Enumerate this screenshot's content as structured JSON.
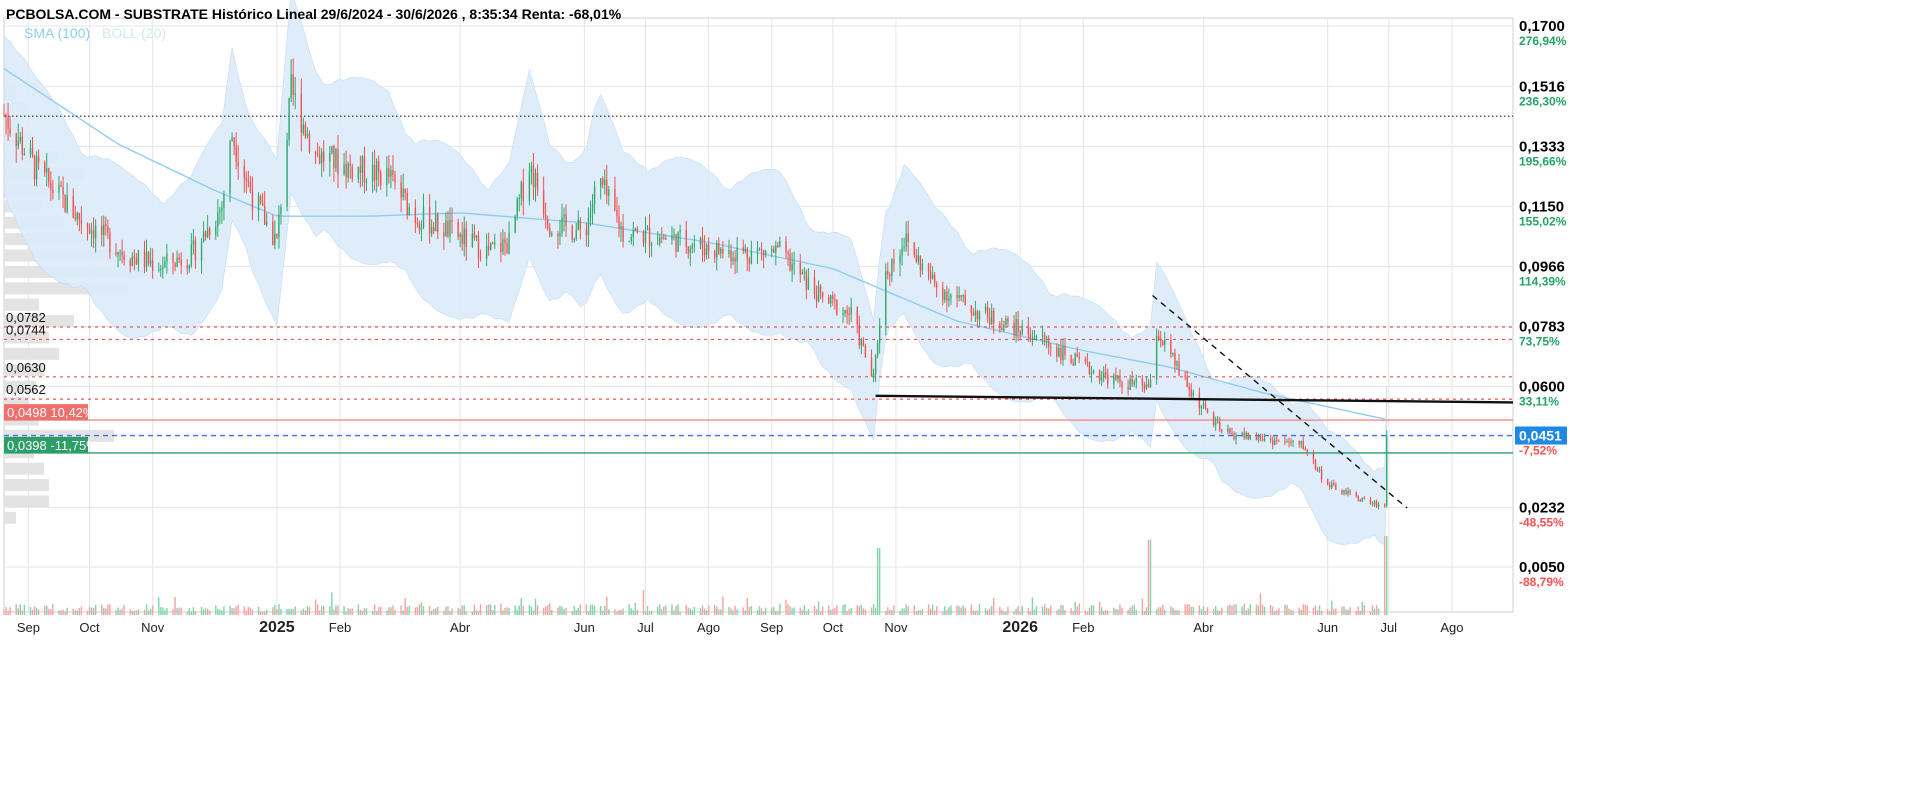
{
  "header": {
    "title": "PCBOLSA.COM - SUBSTRATE Histórico Lineal 29/6/2024 - 30/6/2026 , 8:35:34 Renta: -68,01%"
  },
  "legend": {
    "items": [
      {
        "label": "SMA (100)",
        "color": "#8fcdf0"
      },
      {
        "label": "BOLL (20)",
        "color": "#d4e6f4"
      }
    ]
  },
  "colors": {
    "up_candle": "#2eaa6b",
    "down_candle": "#ef5350",
    "volume_up": "#7fd4a8",
    "volume_down": "#f4a3a1",
    "sma": "#8fcdf0",
    "boll_fill": "#dcecfa",
    "resistance_red": "#ef5350",
    "support_green": "#26a269",
    "current_price_blue": "#3a6ff7",
    "current_price_badge": "#1e88e5",
    "grid": "#e6e6e6",
    "pct_positive": "#26a269",
    "pct_negative": "#ef5350"
  },
  "chart_data": {
    "type": "candlestick",
    "title": "PCBOLSA.COM - SUBSTRATE Histórico Lineal 29/6/2024 - 30/6/2026 , 8:35:34 Renta: -68,01%",
    "x_range": [
      "2024-08-20",
      "2026-08-31"
    ],
    "y_range": [
      0.0,
      0.17
    ],
    "right_axis_ticks": [
      {
        "price": "0,1700",
        "pct": "276,94%",
        "sign": "pos"
      },
      {
        "price": "0,1516",
        "pct": "236,30%",
        "sign": "pos"
      },
      {
        "price": "0,1333",
        "pct": "195,66%",
        "sign": "pos"
      },
      {
        "price": "0,1150",
        "pct": "155,02%",
        "sign": "pos"
      },
      {
        "price": "0,0966",
        "pct": "114,39%",
        "sign": "pos"
      },
      {
        "price": "0,0783",
        "pct": "73,75%",
        "sign": "pos"
      },
      {
        "price": "0,0600",
        "pct": "33,11%",
        "sign": "pos"
      },
      {
        "price": "0,0451",
        "pct": "",
        "sign": "current"
      },
      {
        "price": "",
        "pct": "-7,52%",
        "sign": "neg"
      },
      {
        "price": "0,0232",
        "pct": "-48,55%",
        "sign": "neg"
      },
      {
        "price": "0,0050",
        "pct": "-88,79%",
        "sign": "neg"
      }
    ],
    "x_ticks": [
      {
        "label": "Sep",
        "date": "2024-09-01",
        "bold": false
      },
      {
        "label": "Oct",
        "date": "2024-10-01",
        "bold": false
      },
      {
        "label": "Nov",
        "date": "2024-11-01",
        "bold": false
      },
      {
        "label": "2025",
        "date": "2025-01-01",
        "bold": true
      },
      {
        "label": "Feb",
        "date": "2025-02-01",
        "bold": false
      },
      {
        "label": "Abr",
        "date": "2025-04-01",
        "bold": false
      },
      {
        "label": "Jun",
        "date": "2025-06-01",
        "bold": false
      },
      {
        "label": "Jul",
        "date": "2025-07-01",
        "bold": false
      },
      {
        "label": "Ago",
        "date": "2025-08-01",
        "bold": false
      },
      {
        "label": "Sep",
        "date": "2025-09-01",
        "bold": false
      },
      {
        "label": "Oct",
        "date": "2025-10-01",
        "bold": false
      },
      {
        "label": "Nov",
        "date": "2025-11-01",
        "bold": false
      },
      {
        "label": "2026",
        "date": "2026-01-01",
        "bold": true
      },
      {
        "label": "Feb",
        "date": "2026-02-01",
        "bold": false
      },
      {
        "label": "Abr",
        "date": "2026-04-01",
        "bold": false
      },
      {
        "label": "Jun",
        "date": "2026-06-01",
        "bold": false
      },
      {
        "label": "Jul",
        "date": "2026-07-01",
        "bold": false
      },
      {
        "label": "Ago",
        "date": "2026-08-01",
        "bold": false
      }
    ],
    "price_levels": [
      {
        "label": "0,0782",
        "value": 0.0782,
        "style": "dotted-red"
      },
      {
        "label": "0,0744",
        "value": 0.0744,
        "style": "dotted-red"
      },
      {
        "label": "0,0630",
        "value": 0.063,
        "style": "dotted-red"
      },
      {
        "label": "0,0562",
        "value": 0.0562,
        "style": "dotted-red"
      },
      {
        "label": "",
        "value": 0.1425,
        "style": "dotted-black"
      }
    ],
    "resistance": {
      "price": "0,0498",
      "pct": "10,42%",
      "value": 0.0498
    },
    "support": {
      "price": "0,0398",
      "pct": "-11,75%",
      "value": 0.0398
    },
    "current": {
      "price": "0,0451",
      "value": 0.0451
    },
    "trendlines": [
      {
        "kind": "solid",
        "from": {
          "date": "2025-10-22",
          "y": 0.0572
        },
        "to": {
          "date": "2026-08-31",
          "y": 0.0552
        }
      },
      {
        "kind": "dashed",
        "from": {
          "date": "2026-03-07",
          "y": 0.0878
        },
        "to": {
          "date": "2026-07-10",
          "y": 0.023
        }
      }
    ],
    "price_anchors": [
      [
        "2024-08-20",
        0.143
      ],
      [
        "2024-09-05",
        0.126
      ],
      [
        "2024-09-25",
        0.112
      ],
      [
        "2024-10-20",
        0.1
      ],
      [
        "2024-11-05",
        0.097
      ],
      [
        "2024-11-20",
        0.1
      ],
      [
        "2024-12-05",
        0.115
      ],
      [
        "2024-12-10",
        0.137
      ],
      [
        "2024-12-20",
        0.118
      ],
      [
        "2025-01-01",
        0.104
      ],
      [
        "2025-01-08",
        0.15
      ],
      [
        "2025-01-20",
        0.131
      ],
      [
        "2025-02-05",
        0.127
      ],
      [
        "2025-02-25",
        0.124
      ],
      [
        "2025-03-10",
        0.112
      ],
      [
        "2025-03-25",
        0.108
      ],
      [
        "2025-04-15",
        0.101
      ],
      [
        "2025-04-25",
        0.104
      ],
      [
        "2025-05-05",
        0.128
      ],
      [
        "2025-05-15",
        0.11
      ],
      [
        "2025-06-01",
        0.107
      ],
      [
        "2025-06-08",
        0.123
      ],
      [
        "2025-06-20",
        0.107
      ],
      [
        "2025-07-15",
        0.105
      ],
      [
        "2025-08-10",
        0.101
      ],
      [
        "2025-09-05",
        0.101
      ],
      [
        "2025-09-25",
        0.087
      ],
      [
        "2025-10-10",
        0.082
      ],
      [
        "2025-10-21",
        0.062
      ],
      [
        "2025-10-26",
        0.093
      ],
      [
        "2025-11-05",
        0.105
      ],
      [
        "2025-11-20",
        0.091
      ],
      [
        "2025-12-10",
        0.083
      ],
      [
        "2026-01-10",
        0.075
      ],
      [
        "2026-02-01",
        0.066
      ],
      [
        "2026-02-20",
        0.061
      ],
      [
        "2026-03-06",
        0.06
      ],
      [
        "2026-03-08",
        0.078
      ],
      [
        "2026-03-25",
        0.059
      ],
      [
        "2026-04-10",
        0.046
      ],
      [
        "2026-05-01",
        0.044
      ],
      [
        "2026-05-20",
        0.042
      ],
      [
        "2026-06-01",
        0.03
      ],
      [
        "2026-06-20",
        0.025
      ],
      [
        "2026-06-29",
        0.0235
      ],
      [
        "2026-06-30",
        0.0451
      ]
    ],
    "sma_anchors": [
      [
        "2024-08-20",
        0.157
      ],
      [
        "2024-10-15",
        0.134
      ],
      [
        "2024-12-01",
        0.12
      ],
      [
        "2025-01-01",
        0.112
      ],
      [
        "2025-02-15",
        0.112
      ],
      [
        "2025-04-01",
        0.113
      ],
      [
        "2025-06-01",
        0.11
      ],
      [
        "2025-08-01",
        0.104
      ],
      [
        "2025-10-01",
        0.096
      ],
      [
        "2025-12-01",
        0.08
      ],
      [
        "2026-02-01",
        0.071
      ],
      [
        "2026-03-15",
        0.066
      ],
      [
        "2026-05-01",
        0.058
      ],
      [
        "2026-06-30",
        0.05
      ]
    ],
    "boll_width": 0.011,
    "volume_spikes": [
      [
        "2025-10-24",
        0.55
      ],
      [
        "2026-03-06",
        0.62
      ],
      [
        "2026-06-30",
        0.65
      ]
    ]
  }
}
